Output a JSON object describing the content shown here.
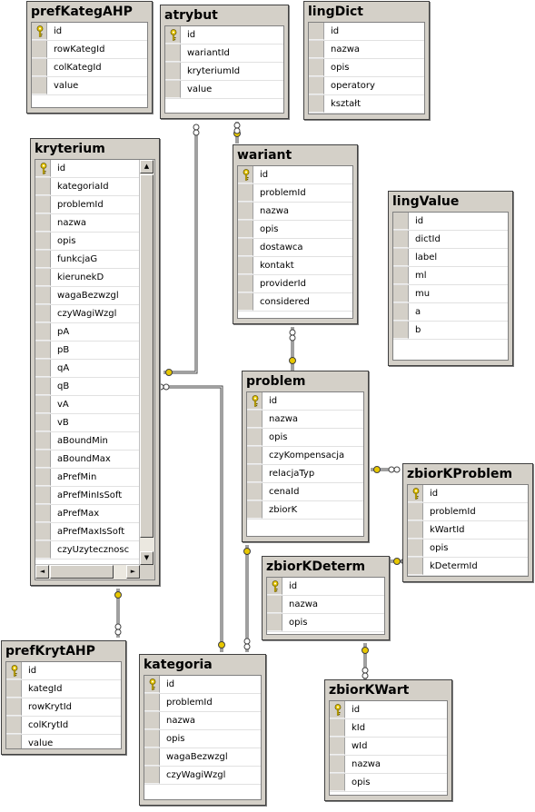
{
  "tables": {
    "prefKategAHP": {
      "title": "prefKategAHP",
      "columns": [
        {
          "name": "id",
          "pk": true
        },
        {
          "name": "rowKategId"
        },
        {
          "name": "colKategId"
        },
        {
          "name": "value"
        }
      ]
    },
    "atrybut": {
      "title": "atrybut",
      "columns": [
        {
          "name": "id",
          "pk": true
        },
        {
          "name": "wariantId"
        },
        {
          "name": "kryteriumId"
        },
        {
          "name": "value"
        }
      ]
    },
    "lingDict": {
      "title": "lingDict",
      "columns": [
        {
          "name": "id"
        },
        {
          "name": "nazwa"
        },
        {
          "name": "opis"
        },
        {
          "name": "operatory"
        },
        {
          "name": "kształt"
        }
      ]
    },
    "kryterium": {
      "title": "kryterium",
      "columns": [
        {
          "name": "id",
          "pk": true
        },
        {
          "name": "kategoriaId"
        },
        {
          "name": "problemId"
        },
        {
          "name": "nazwa"
        },
        {
          "name": "opis"
        },
        {
          "name": "funkcjaG"
        },
        {
          "name": "kierunekD"
        },
        {
          "name": "wagaBezwzgl"
        },
        {
          "name": "czyWagiWzgl"
        },
        {
          "name": "pA"
        },
        {
          "name": "pB"
        },
        {
          "name": "qA"
        },
        {
          "name": "qB"
        },
        {
          "name": "vA"
        },
        {
          "name": "vB"
        },
        {
          "name": "aBoundMin"
        },
        {
          "name": "aBoundMax"
        },
        {
          "name": "aPrefMin"
        },
        {
          "name": "aPrefMinIsSoft"
        },
        {
          "name": "aPrefMax"
        },
        {
          "name": "aPrefMaxIsSoft"
        },
        {
          "name": "czyUzytecznosc"
        }
      ]
    },
    "wariant": {
      "title": "wariant",
      "columns": [
        {
          "name": "id",
          "pk": true
        },
        {
          "name": "problemId"
        },
        {
          "name": "nazwa"
        },
        {
          "name": "opis"
        },
        {
          "name": "dostawca"
        },
        {
          "name": "kontakt"
        },
        {
          "name": "providerId"
        },
        {
          "name": "considered"
        }
      ]
    },
    "lingValue": {
      "title": "lingValue",
      "columns": [
        {
          "name": "id"
        },
        {
          "name": "dictId"
        },
        {
          "name": "label"
        },
        {
          "name": "ml"
        },
        {
          "name": "mu"
        },
        {
          "name": "a"
        },
        {
          "name": "b"
        }
      ]
    },
    "problem": {
      "title": "problem",
      "columns": [
        {
          "name": "id",
          "pk": true
        },
        {
          "name": "nazwa"
        },
        {
          "name": "opis"
        },
        {
          "name": "czyKompensacja"
        },
        {
          "name": "relacjaTyp"
        },
        {
          "name": "cenaId"
        },
        {
          "name": "zbiorK"
        }
      ]
    },
    "zbiorKProblem": {
      "title": "zbiorKProblem",
      "columns": [
        {
          "name": "id",
          "pk": true
        },
        {
          "name": "problemId"
        },
        {
          "name": "kWartId"
        },
        {
          "name": "opis"
        },
        {
          "name": "kDetermId"
        }
      ]
    },
    "zbiorKDeterm": {
      "title": "zbiorKDeterm",
      "columns": [
        {
          "name": "id",
          "pk": true
        },
        {
          "name": "nazwa"
        },
        {
          "name": "opis"
        }
      ]
    },
    "prefKrytAHP": {
      "title": "prefKrytAHP",
      "columns": [
        {
          "name": "id",
          "pk": true
        },
        {
          "name": "kategId"
        },
        {
          "name": "rowKrytId"
        },
        {
          "name": "colKrytId"
        },
        {
          "name": "value"
        }
      ]
    },
    "kategoria": {
      "title": "kategoria",
      "columns": [
        {
          "name": "id",
          "pk": true
        },
        {
          "name": "problemId"
        },
        {
          "name": "nazwa"
        },
        {
          "name": "opis"
        },
        {
          "name": "wagaBezwzgl"
        },
        {
          "name": "czyWagiWzgl"
        }
      ]
    },
    "zbiorKWart": {
      "title": "zbiorKWart",
      "columns": [
        {
          "name": "id",
          "pk": true
        },
        {
          "name": "kId"
        },
        {
          "name": "wId"
        },
        {
          "name": "nazwa"
        },
        {
          "name": "opis"
        }
      ]
    }
  },
  "scroll_icons": {
    "up": "▲",
    "down": "▼",
    "left": "◄",
    "right": "►"
  },
  "colors": {
    "window_bg": "#d4d0c8",
    "key_gold": "#e8c800",
    "line": "#404040"
  }
}
